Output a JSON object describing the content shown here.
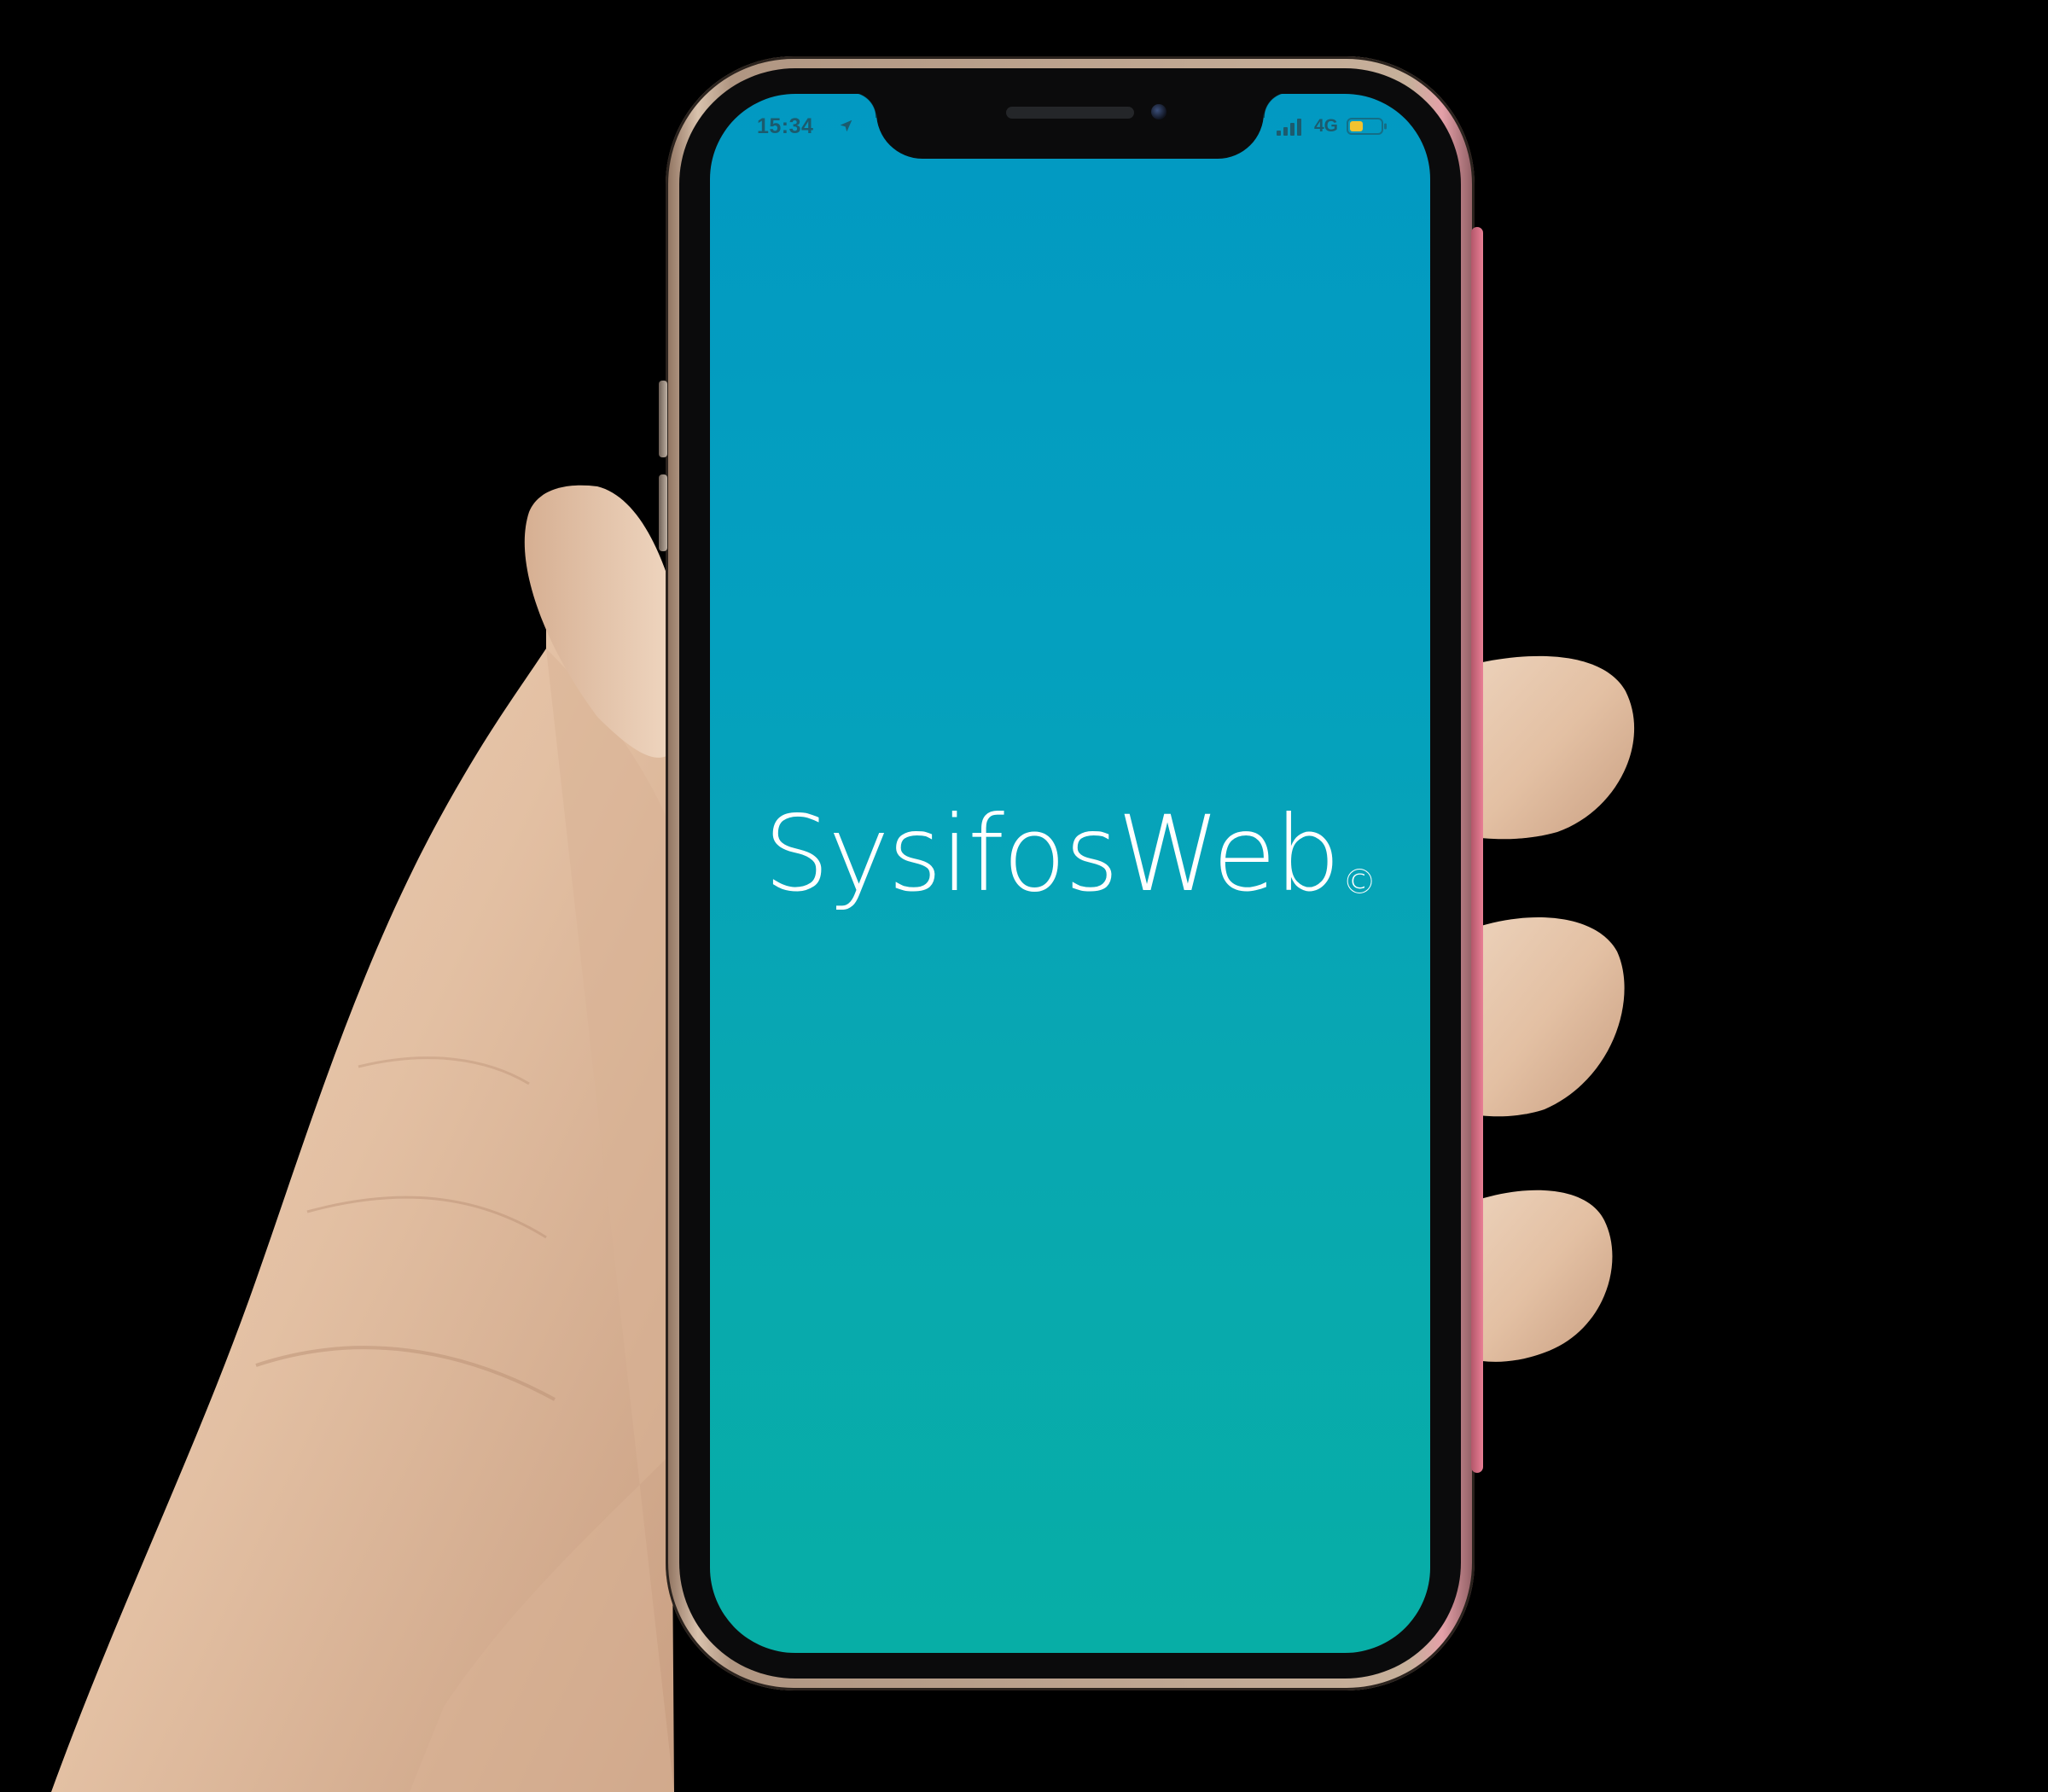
{
  "status_bar": {
    "time": "15:34",
    "network": "4G",
    "icons": [
      "location-arrow-icon",
      "cellular-signal-icon",
      "battery-low-icon"
    ],
    "battery_color": "#f2c330"
  },
  "app": {
    "name": "SysifosWeb",
    "copyright_symbol": "©"
  },
  "colors": {
    "screen_gradient_top": "#0299c2",
    "screen_gradient_bottom": "#07aea6",
    "title_color": "#ffffff",
    "background": "#000000"
  }
}
